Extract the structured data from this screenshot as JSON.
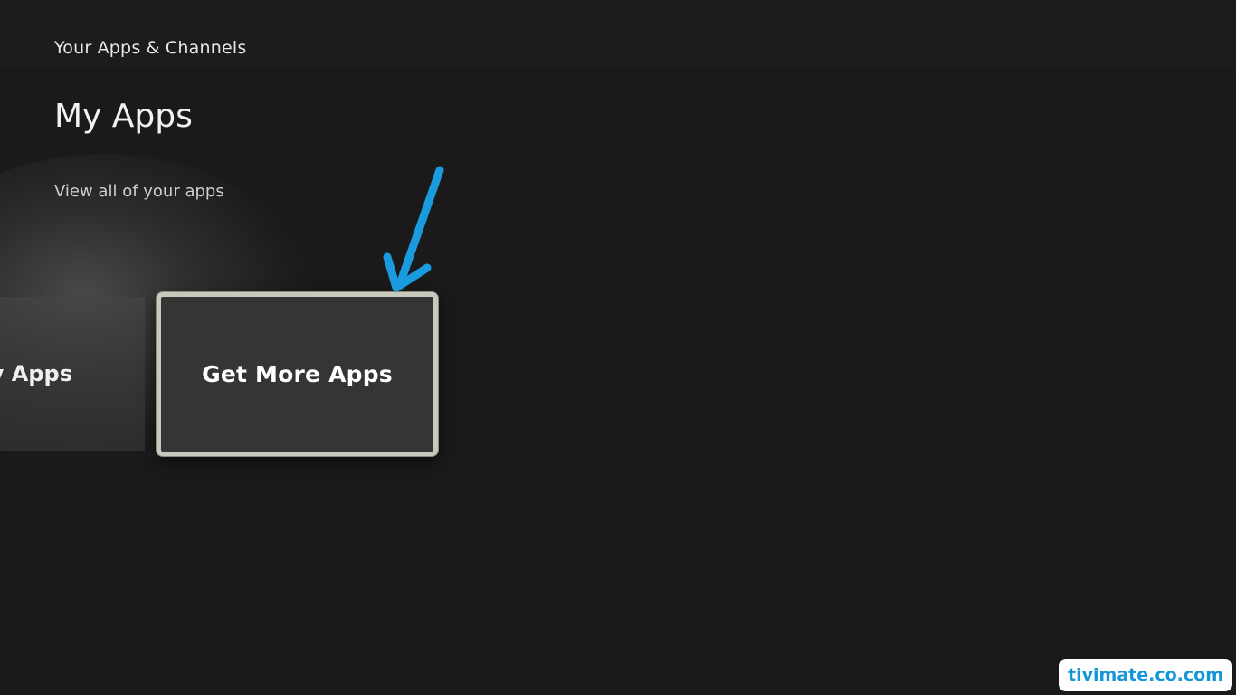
{
  "header": {
    "section_title": "Your Apps & Channels"
  },
  "main": {
    "page_title": "My Apps",
    "subtitle": "View all of your apps",
    "tiles": [
      {
        "label": "My Apps"
      },
      {
        "label": "Get More Apps"
      }
    ]
  },
  "annotation": {
    "arrow_color": "#1a9be0",
    "arrow_icon": "arrow-down-icon"
  },
  "watermark": {
    "text": "tivimate.co.com",
    "color": "#1296d8"
  }
}
